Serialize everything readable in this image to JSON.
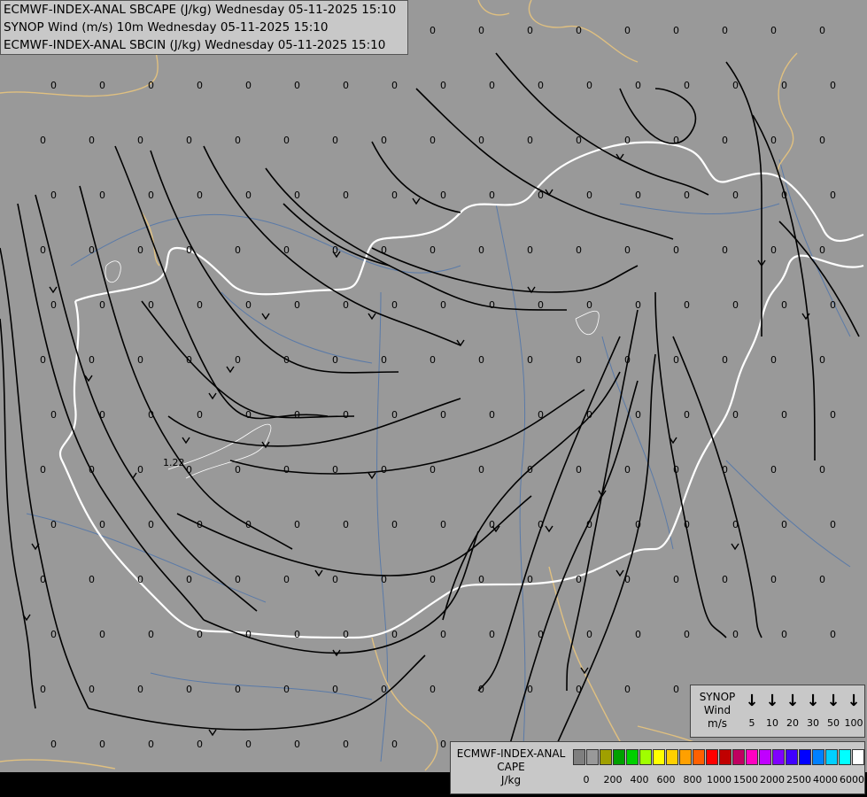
{
  "header": {
    "line1": "ECMWF-INDEX-ANAL SBCAPE (J/kg) Wednesday 05-11-2025 15:10",
    "line2": "SYNOP Wind (m/s) 10m Wednesday 05-11-2025 15:10",
    "line3": "ECMWF-INDEX-ANAL SBCIN (J/kg) Wednesday 05-11-2025 15:10"
  },
  "map": {
    "background_color": "#999999",
    "border_color_country": "#ffffff",
    "border_color_other": "#e0c080",
    "river_color": "#5a7aa8",
    "streamline_color": "#000000",
    "cape_labels": [
      "0",
      "1.22"
    ]
  },
  "wind_legend": {
    "title_lines": [
      "SYNOP",
      "Wind",
      "m/s"
    ],
    "arrow_icon": "down-arrow-icon",
    "values": [
      "5",
      "10",
      "20",
      "30",
      "50",
      "100"
    ]
  },
  "cape_legend": {
    "title_lines": [
      "ECMWF-INDEX-ANAL",
      "CAPE",
      "J/kg"
    ],
    "colors": [
      "#7f7f7f",
      "#999999",
      "#a0a000",
      "#00a000",
      "#00d000",
      "#a0ff00",
      "#ffff00",
      "#ffd000",
      "#ffa000",
      "#ff6000",
      "#ff0000",
      "#c00000",
      "#c00060",
      "#ff00c0",
      "#c000ff",
      "#8000ff",
      "#4000ff",
      "#0000ff",
      "#0080ff",
      "#00d0ff",
      "#00ffff",
      "#ffffff"
    ],
    "ticks": [
      "0",
      "200",
      "400",
      "600",
      "800",
      "1000",
      "1500",
      "2000",
      "2500",
      "4000",
      "6000"
    ]
  }
}
